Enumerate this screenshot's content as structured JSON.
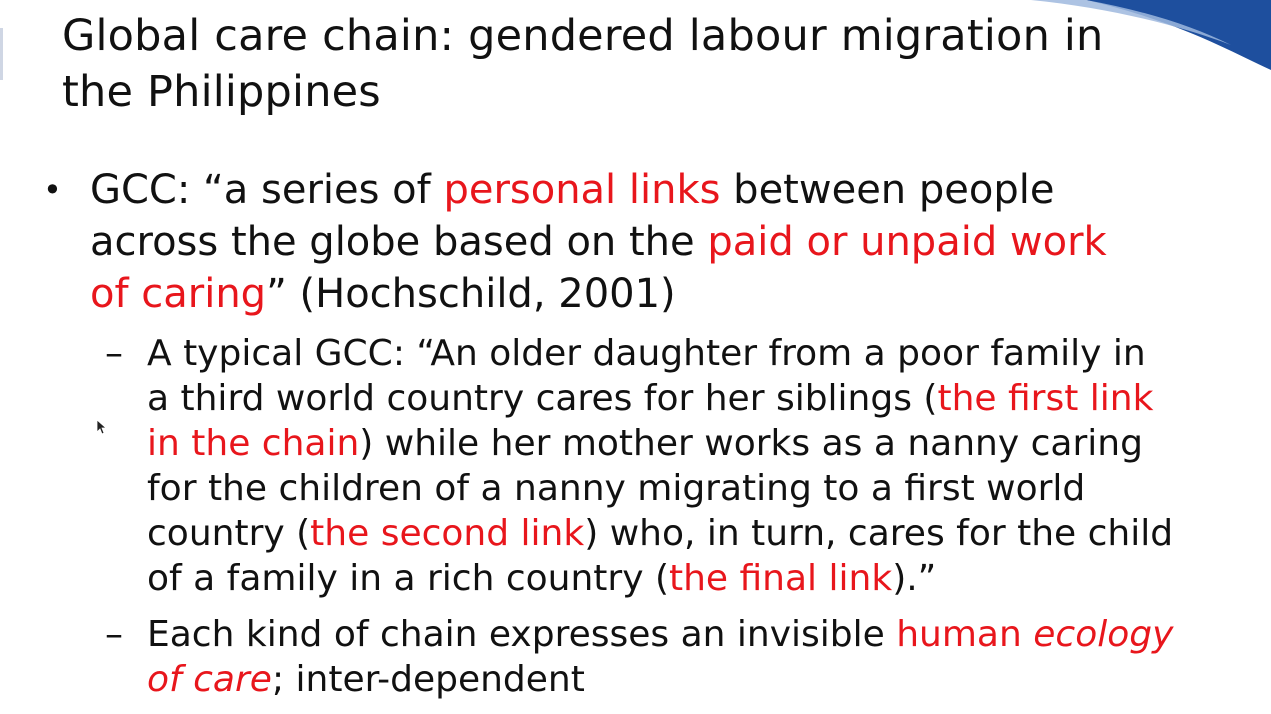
{
  "colors": {
    "highlight": "#e8161c",
    "text": "#111111",
    "accent_blue": "#1e4f9e"
  },
  "title": {
    "line1": "Global care chain: gendered labour migration in",
    "line2": "the Philippines"
  },
  "bullet1": {
    "marker": "•",
    "l1_a": "GCC: “a series of ",
    "l1_b": "personal links",
    "l1_c": " between people",
    "l2_a": "across the globe based on the ",
    "l2_b": "paid or unpaid work",
    "l3_a": "of caring",
    "l3_b": "” (Hochschild, 2001)"
  },
  "sub1": {
    "marker": "–",
    "l1": "A typical GCC: “An older daughter from a poor family in",
    "l2_a": "a third world country cares for her siblings (",
    "l2_b": "the first link",
    "l3_a": "in the chain",
    "l3_b": ") while her mother works as a nanny caring",
    "l4": "for the children of a nanny migrating to a first world",
    "l5_a": "country (",
    "l5_b": "the second link",
    "l5_c": ") who, in turn, cares for the child",
    "l6_a": "of a family in a rich country (",
    "l6_b": "the final link",
    "l6_c": ").”"
  },
  "sub2": {
    "marker": "–",
    "l1_a": "Each kind of chain expresses an invisible ",
    "l1_b": "human ",
    "l1_c": "ecology",
    "l2_a": "of care",
    "l2_b": "; inter-dependent"
  },
  "icons": {
    "cursor": "mouse-pointer-icon"
  }
}
